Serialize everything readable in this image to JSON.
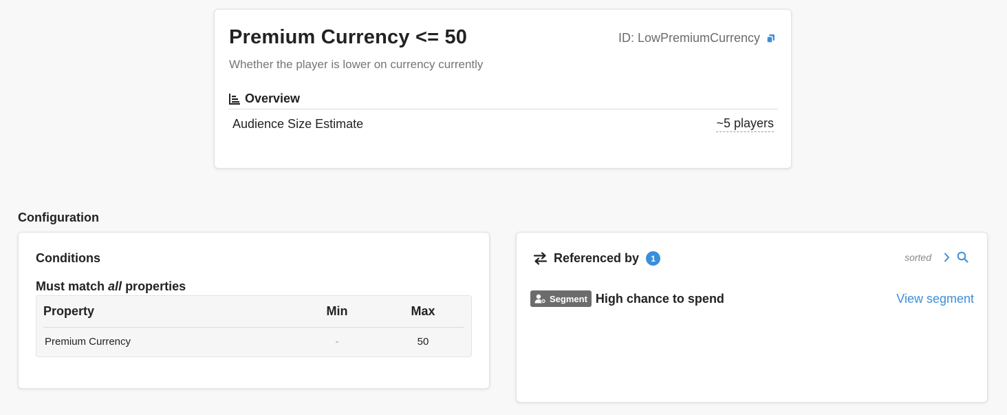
{
  "header": {
    "title": "Premium Currency <= 50",
    "id_label": "ID: LowPremiumCurrency",
    "copy_icon": "copy-icon",
    "subtitle": "Whether the player is lower on currency currently"
  },
  "overview": {
    "heading": "Overview",
    "icon": "chart-icon",
    "rows": [
      {
        "label": "Audience Size Estimate",
        "value": "~5 players"
      }
    ]
  },
  "configuration": {
    "heading": "Configuration",
    "conditions": {
      "title": "Conditions",
      "match_prefix": "Must match",
      "match_mode": "all",
      "match_suffix": "properties",
      "columns": [
        "Property",
        "Min",
        "Max"
      ],
      "rows": [
        {
          "property": "Premium Currency",
          "min": "-",
          "max": "50"
        }
      ]
    }
  },
  "referenced_by": {
    "title": "Referenced by",
    "count": "1",
    "sorted_label": "sorted",
    "items": [
      {
        "type": "Segment",
        "name": "High chance to spend",
        "action": "View segment"
      }
    ]
  },
  "colors": {
    "accent": "#3b8fd9",
    "badge_bg": "#6c6c6c",
    "page_bg": "#f8f8f8"
  }
}
